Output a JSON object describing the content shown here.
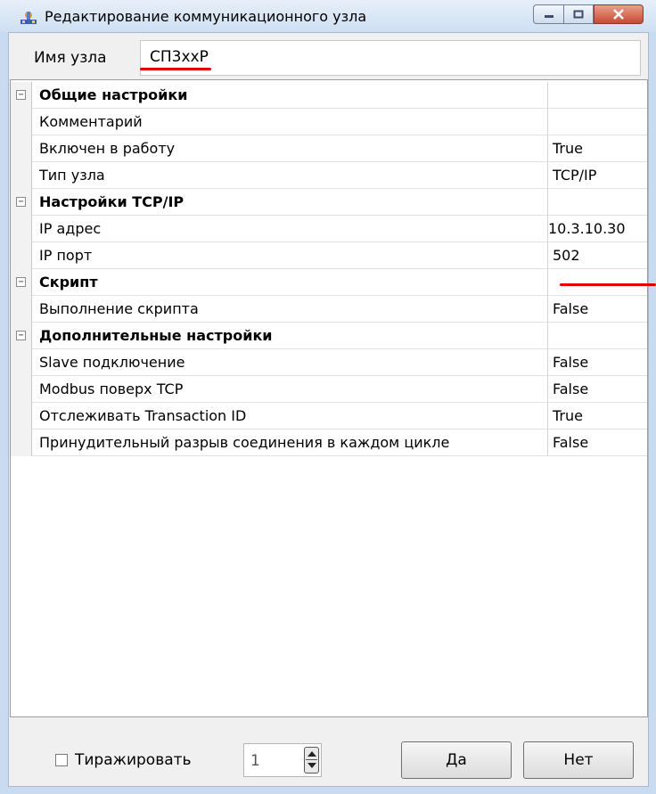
{
  "window": {
    "title": "Редактирование  коммуникационного узла"
  },
  "node_name": {
    "label": "Имя узла",
    "value": "СП3ххР"
  },
  "properties": [
    {
      "type": "category",
      "name": "Общие настройки",
      "value": ""
    },
    {
      "type": "item",
      "name": "Комментарий",
      "value": ""
    },
    {
      "type": "item",
      "name": "Включен в работу",
      "value": "True"
    },
    {
      "type": "item",
      "name": "Тип узла",
      "value": "TCP/IP"
    },
    {
      "type": "category",
      "name": "Настройки TCP/IP",
      "value": ""
    },
    {
      "type": "item",
      "name": "IP адрес",
      "value": "10.3.10.30"
    },
    {
      "type": "item",
      "name": "IP порт",
      "value": "502"
    },
    {
      "type": "category",
      "name": "Скрипт",
      "value": ""
    },
    {
      "type": "item",
      "name": "Выполнение скрипта",
      "value": "False"
    },
    {
      "type": "category",
      "name": "Дополнительные настройки",
      "value": ""
    },
    {
      "type": "item",
      "name": "Slave подключение",
      "value": "False"
    },
    {
      "type": "item",
      "name": "Modbus поверх TCP",
      "value": "False"
    },
    {
      "type": "item",
      "name": "Отслеживать Transaction ID",
      "value": "True"
    },
    {
      "type": "item",
      "name": "Принудительный разрыв соединения в каждом цикле",
      "value": "False"
    }
  ],
  "footer": {
    "replicate_label": "Тиражировать",
    "replicate_checked": false,
    "count": "1",
    "ok_label": "Да",
    "cancel_label": "Нет"
  },
  "icons": {
    "collapse": "minus-icon",
    "app": "network-node-icon"
  },
  "colors": {
    "highlight": "#e00000",
    "titlebar": "#cfdff2",
    "close": "#c74a33"
  }
}
